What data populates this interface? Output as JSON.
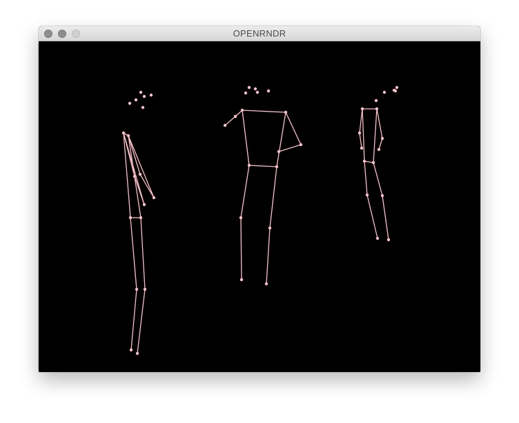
{
  "window": {
    "title": "OPENRNDR",
    "buttons": [
      "close",
      "minimize",
      "zoom"
    ]
  },
  "canvas": {
    "background_color": "#000000",
    "stroke_color": "#ffc0cb",
    "joint_color": "#ffc0cb"
  }
}
